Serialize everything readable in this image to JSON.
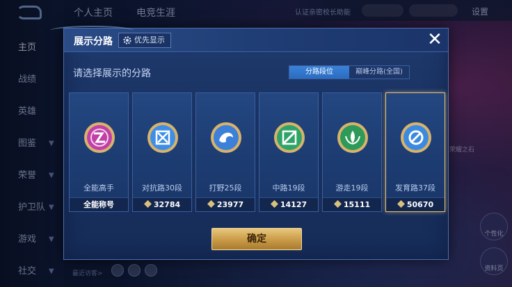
{
  "background": {
    "sidebar": {
      "items": [
        {
          "label": "主页",
          "active": true
        },
        {
          "label": "战绩"
        },
        {
          "label": "英雄"
        },
        {
          "label": "图鉴"
        },
        {
          "label": "荣誉"
        },
        {
          "label": "护卫队"
        },
        {
          "label": "游戏"
        },
        {
          "label": "社交"
        }
      ]
    },
    "top_tabs": [
      "个人主页",
      "电竞生涯"
    ],
    "top_right_text": "认证亲密校长助能",
    "settings_label": "设置",
    "bottom_hint": "最近访客>",
    "right_edge_text": "荣耀之石",
    "right_buttons": [
      "个性化",
      "资料页"
    ]
  },
  "dialog": {
    "title": "展示分路",
    "priority_label": "优先显示",
    "prompt": "请选择展示的分路",
    "segment_tabs": [
      {
        "label": "分路段位",
        "active": true
      },
      {
        "label": "巅峰分路(全国)",
        "active": false
      }
    ],
    "cards": [
      {
        "lane": "全能高手",
        "score": "全能称号",
        "has_diamond": false,
        "emblem_color": "#c13fa6",
        "emblem": "allround-emblem-icon",
        "selected": false
      },
      {
        "lane": "对抗路30段",
        "score": "32784",
        "has_diamond": true,
        "emblem_color": "#3f8ee6",
        "emblem": "clash-lane-emblem-icon",
        "selected": false
      },
      {
        "lane": "打野25段",
        "score": "23977",
        "has_diamond": true,
        "emblem_color": "#3c80d9",
        "emblem": "jungle-emblem-icon",
        "selected": false
      },
      {
        "lane": "中路19段",
        "score": "14127",
        "has_diamond": true,
        "emblem_color": "#2fa468",
        "emblem": "mid-lane-emblem-icon",
        "selected": false
      },
      {
        "lane": "游走19段",
        "score": "15111",
        "has_diamond": true,
        "emblem_color": "#2e9a5a",
        "emblem": "roam-emblem-icon",
        "selected": false
      },
      {
        "lane": "发育路37段",
        "score": "50670",
        "has_diamond": true,
        "emblem_color": "#3b8ae0",
        "emblem": "farm-lane-emblem-icon",
        "selected": true
      }
    ],
    "confirm_label": "确定"
  },
  "colors": {
    "gold": "#e3c27a",
    "accent_blue": "#3a83d9",
    "dialog_bg": "#1a3364"
  }
}
